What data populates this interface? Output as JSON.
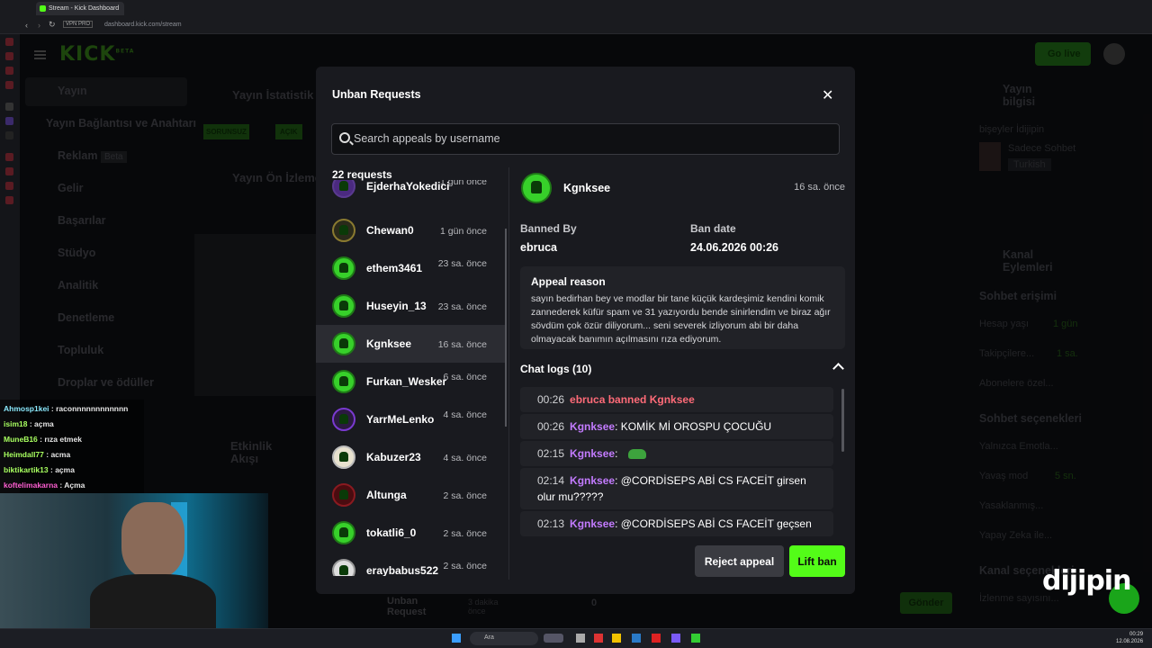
{
  "browser": {
    "tab_title": "Stream - Kick Dashboard",
    "url": "dashboard.kick.com/stream",
    "vpn": "VPN PRO"
  },
  "kick": {
    "logo": "KICK",
    "logo_beta": "BETA",
    "go_live": "Go live"
  },
  "sidebar": {
    "items": [
      {
        "label": "Yayın"
      },
      {
        "label": "Yayın Bağlantısı ve Anahtarı"
      },
      {
        "label": "Reklam",
        "badge": "Beta"
      },
      {
        "label": "Gelir"
      },
      {
        "label": "Başarılar"
      },
      {
        "label": "Stüdyo"
      },
      {
        "label": "Analitik"
      },
      {
        "label": "Denetleme"
      },
      {
        "label": "Topluluk"
      },
      {
        "label": "Droplar ve ödüller"
      }
    ]
  },
  "background": {
    "stats_title": "Yayın İstatistik",
    "tag_problem": "SORUNSUZ",
    "tag_open": "AÇIK",
    "preview_title": "Yayın Ön İzleme",
    "activity_title": "Etkinlik Akışı",
    "unban_label": "Unban Request",
    "unban_time": "3 dakika önce",
    "send": "Gönder",
    "count_zero": "0",
    "info_title": "Yayın bilgisi",
    "info_desc": "bişeyler İdijipin",
    "info_category": "Sadece Sohbet",
    "info_lang": "Turkish",
    "actions_title": "Kanal Eylemleri",
    "chat_access": "Sohbet erişimi",
    "account_age": "Hesap yaşı",
    "account_age_val": "1 gün",
    "followers": "Takipçilere...",
    "followers_val": "1 sa.",
    "subs": "Abonelere özel...",
    "chat_options": "Sohbet seçenekleri",
    "emotes": "Yalnızca Emotla...",
    "slow": "Yavaş mod",
    "slow_val": "5 sn.",
    "banned_words": "Yasaklanmış...",
    "ai": "Yapay Zeka ile...",
    "channel_options": "Kanal seçenekleri",
    "viewers": "İzlenme sayısını..."
  },
  "overlay_chat": [
    {
      "user": "Ahmosp1kei",
      "msg": "raconnnnnnnnnnnn",
      "color": "#8be9fd"
    },
    {
      "user": "isim18",
      "msg": "açma",
      "color": "#a8ff60"
    },
    {
      "user": "MuneB16",
      "msg": "rıza etmek",
      "color": "#a8ff60"
    },
    {
      "user": "Heimdall77",
      "msg": "acma",
      "color": "#a8ff60"
    },
    {
      "user": "biktikartik13",
      "msg": "açma",
      "color": "#a8ff60"
    },
    {
      "user": "koftelimakarna",
      "msg": "Açma",
      "color": "#ff5fd2"
    }
  ],
  "modal": {
    "title": "Unban Requests",
    "search_placeholder": "Search appeals by username",
    "count": "22 requests",
    "requests": [
      {
        "name": "EjderhaYokedici",
        "time": "1 gün önce"
      },
      {
        "name": "Chewan0",
        "time": "1 gün önce"
      },
      {
        "name": "ethem3461",
        "time": "23 sa. önce"
      },
      {
        "name": "Huseyin_13",
        "time": "23 sa. önce"
      },
      {
        "name": "Kgnksee",
        "time": "16 sa. önce"
      },
      {
        "name": "Furkan_Wesker",
        "time": "6 sa. önce"
      },
      {
        "name": "YarrMeLenko",
        "time": "4 sa. önce"
      },
      {
        "name": "Kabuzer23",
        "time": "4 sa. önce"
      },
      {
        "name": "Altunga",
        "time": "2 sa. önce"
      },
      {
        "name": "tokatli6_0",
        "time": "2 sa. önce"
      },
      {
        "name": "eraybabus522",
        "time": "2 sa. önce"
      }
    ],
    "selected": {
      "name": "Kgnksee",
      "time": "16 sa. önce",
      "banned_by_label": "Banned By",
      "banned_by": "ebruca",
      "ban_date_label": "Ban date",
      "ban_date": "24.06.2026 00:26",
      "appeal_reason_label": "Appeal reason",
      "appeal_reason": "sayın bedirhan bey ve modlar bir tane küçük kardeşimiz kendini komik zannederek küfür spam ve 31 yazıyordu bende sinirlendim ve biraz ağır sövdüm çok özür diliyorum... seni severek izliyorum abi bir daha olmayacak banımın açılmasını rıza ediyorum.",
      "chat_logs_label": "Chat logs (10)"
    },
    "logs": [
      {
        "time": "00:26",
        "system": "ebruca banned Kgnksee"
      },
      {
        "time": "00:26",
        "user": "Kgnksee",
        "msg": "KOMİK Mİ OROSPU ÇOCUĞU"
      },
      {
        "time": "02:15",
        "user": "Kgnksee",
        "msg": ""
      },
      {
        "time": "02:14",
        "user": "Kgnksee",
        "msg": "@CORDİSEPS ABİ CS FACEİT girsen olur mu?????"
      },
      {
        "time": "02:13",
        "user": "Kgnksee",
        "msg": "@CORDİSEPS ABİ CS FACEİT geçsen"
      }
    ],
    "reject": "Reject appeal",
    "lift": "Lift ban"
  },
  "taskbar": {
    "search": "Ara",
    "time": "00:29",
    "date": "12.08.2026"
  },
  "watermark": "dijipin"
}
